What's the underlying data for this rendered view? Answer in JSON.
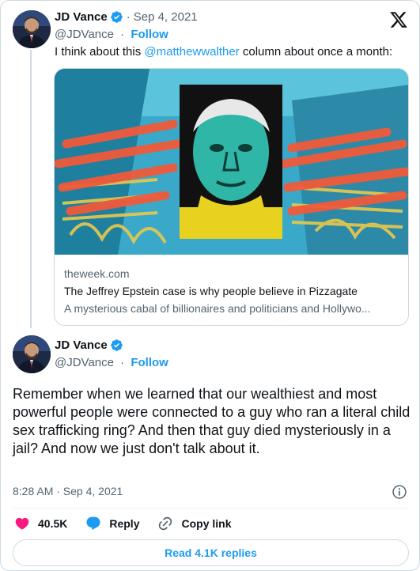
{
  "quoted_tweet": {
    "author_name": "JD Vance",
    "handle": "@JDVance",
    "separator": "·",
    "follow_label": "Follow",
    "date": "Sep 4, 2021",
    "text_before": "I think about this ",
    "mention": "@matthewwalther",
    "text_after": " column about once a month:",
    "link_card": {
      "domain": "theweek.com",
      "title": "The Jeffrey Epstein case is why people believe in Pizzagate",
      "description": "A mysterious cabal of billionaires and politicians and Hollywo..."
    }
  },
  "main_tweet": {
    "author_name": "JD Vance",
    "handle": "@JDVance",
    "separator": "·",
    "follow_label": "Follow",
    "text": "Remember when we learned that our wealthiest and most powerful people were connected to a guy who ran a literal child sex trafficking ring? And then that guy died mysteriously in a jail? And now we just don't talk about it.",
    "timestamp": "8:28 AM · Sep 4, 2021"
  },
  "actions": {
    "like_count": "40.5K",
    "reply_label": "Reply",
    "copy_link_label": "Copy link"
  },
  "read_replies_label": "Read 4.1K replies",
  "icons": {
    "verified": "verified-badge-icon",
    "x_logo": "x-logo-icon",
    "info": "info-icon",
    "like": "heart-icon",
    "reply": "speech-bubble-icon",
    "copy_link": "link-icon"
  },
  "colors": {
    "accent": "#1d9bf0",
    "like": "#f91880",
    "text": "#0f1419",
    "muted": "#536471",
    "border": "#cfd9de"
  }
}
